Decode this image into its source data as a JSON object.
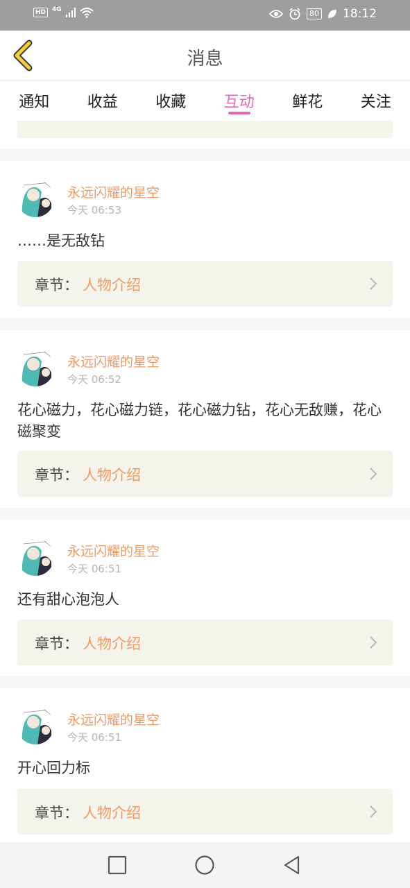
{
  "status_bar": {
    "hd": "HD",
    "network": "4G",
    "battery": "80",
    "time": "18:12"
  },
  "header": {
    "title": "消息"
  },
  "tabs": [
    {
      "label": "通知",
      "active": false
    },
    {
      "label": "收益",
      "active": false
    },
    {
      "label": "收藏",
      "active": false
    },
    {
      "label": "互动",
      "active": true
    },
    {
      "label": "鲜花",
      "active": false
    },
    {
      "label": "关注",
      "active": false
    }
  ],
  "messages": [
    {
      "username": "永远闪耀的星空",
      "time": "今天 06:53",
      "text": "……是无敌钻",
      "chapter_label": "章节：",
      "chapter_name": "人物介绍"
    },
    {
      "username": "永远闪耀的星空",
      "time": "今天 06:52",
      "text": "花心磁力，花心磁力链，花心磁力钻，花心无敌赚，花心磁聚变",
      "chapter_label": "章节：",
      "chapter_name": "人物介绍"
    },
    {
      "username": "永远闪耀的星空",
      "time": "今天 06:51",
      "text": "还有甜心泡泡人",
      "chapter_label": "章节：",
      "chapter_name": "人物介绍"
    },
    {
      "username": "永远闪耀的星空",
      "time": "今天 06:51",
      "text": "开心回力标",
      "chapter_label": "章节：",
      "chapter_name": "人物介绍"
    }
  ],
  "colors": {
    "accent_pink": "#e36ab1",
    "username_orange": "#ee9a63",
    "back_yellow": "#f2cf3b"
  }
}
